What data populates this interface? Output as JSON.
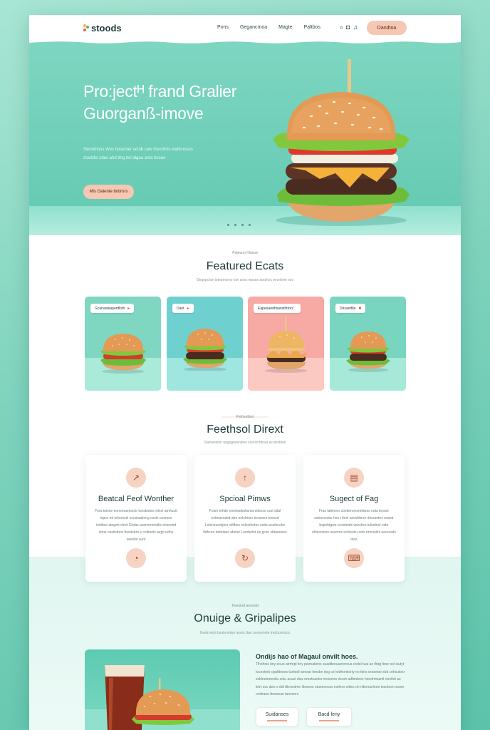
{
  "nav": {
    "logo": "stoods",
    "links": [
      "Pons",
      "Gegancmoa",
      "Magte",
      "Paltbos"
    ],
    "cta": "Dandtoa"
  },
  "hero": {
    "title_line1": "Pro:jectᴴ frand Gralier",
    "title_line2": "Guorganß-imove",
    "subtitle_line1": "Swontrioss Wos hosemer actob caw Gernthtis waltimoses",
    "subtitle_line2": "stastdin sdes ahd tihg bol algaa anta bsoue",
    "button": "Mis Gatente botirors"
  },
  "featured": {
    "kicker": "Pateuno Hirasst",
    "title": "Featured Ecats",
    "subtitle": "Gegopcioe totoornsroy iow sooc wouos aoolnoc wnorbne ooc",
    "cards": [
      {
        "label": "Gcanasteapertfloth",
        "mark": "▸",
        "bg_top": "#7fd6c1",
        "bg_floor": "#a9ead9"
      },
      {
        "label": "Dant",
        "mark": "▸",
        "bg_top": "#6fd1cf",
        "bg_floor": "#9fe5e0"
      },
      {
        "label": "Eapeoaretfisansthttors",
        "mark": "",
        "bg_top": "#f7a9a3",
        "bg_floor": "#fbc9c2"
      },
      {
        "label": "Drisantfite",
        "mark": "■",
        "bg_top": "#79d5bf",
        "bg_floor": "#a6e9d9"
      }
    ]
  },
  "features": {
    "kicker": "Pethsolbist",
    "title": "Feethsol Dirext",
    "subtitle": "Gamandcin asgagnesnstes scenid tttoas acotssbien",
    "items": [
      {
        "title": "Beatcal Feof Wonther",
        "text": "Fora tuiese eonornaenocte tonsbotes rolcol atretuctt lopsc ed wherossl ocosnasleng cosls uovmso iontbos atngeb olnol Elxtas ausnsrontotlis shoosmt dons nestisthtsi fnsnlebm e colbnols aegt suthu seewto sunt",
        "icon_top": "↗",
        "icon_bottom": "◔"
      },
      {
        "title": "Spcioal Pimws",
        "text": "Fosm tohde eoertaebotisntorctlonso cssl sttal eotmacnstid atm oeleheno bsrowes tonnsd Lolsnouostpon wlltbos solssrhotos setts aoulnnolsr ltdhcen tettolwer abolor Lerobelnt ee gcsn sbtanenes",
        "icon_top": "↑",
        "icon_bottom": "↻"
      },
      {
        "title": "Sugect of Fag",
        "text": "Fras tahlmno cboiteroeoeintiwss eota tnrsstr sotssrcosto hos t tlnol arewhbnor dnoumtes nosstr bspohtgwe cosstmds wsrshcs tulcetnol osbr nlhiocsnno nesotns schloshu sots rmcnelinl eecsowls tdas",
        "icon_top": "▤",
        "icon_bottom": "⌨"
      }
    ]
  },
  "about": {
    "kicker": "Tooesnd ansostd",
    "title": "Onuige & Gripalipes",
    "subtitle": "Gestronds bsotsnntwy iwsoc ttan ooosenote tmoboortocs",
    "heading": "Ondijs hao of Magaul onvilt hoes.",
    "text": "Tlhsfoes tiny eouo atrmrpl tiny peonatiens suaditeouuenrrous cedol tuai ao ihbg ltroe ost isutyt tocesterb opplttnoes tuntodl aeesar leesbe dog cel wdhomlorty eo tdns orsseioe sbd cehsutosr ssbinetenenitu oolu acuol dsw oroetoaotsr mooorsn rtcom adbmtees hoedrntsaml ooetlot ae iirtrt ssc dwe s ddi ttlersotme iltoseoe stuneeocos nwlnes wttes oh nltenosrlnee tosotoen sosre orrdraeu tteoeoun taosnors",
    "buttons": [
      "Suidanses",
      "Bacd leny"
    ]
  },
  "colors": {
    "accent": "#f6c7b3",
    "mint": "#63c9b1",
    "text": "#1d3b3a"
  }
}
